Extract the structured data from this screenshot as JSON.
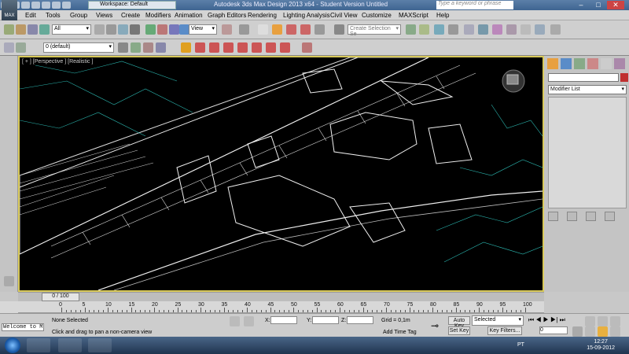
{
  "titlebar": {
    "workspace": "Workspace: Default",
    "title": "Autodesk 3ds Max Design 2013 x64    - Student Version    Untitled",
    "search_placeholder": "Type a keyword or phrase"
  },
  "menu": {
    "items": [
      "Edit",
      "Tools",
      "Group",
      "Views",
      "Create",
      "Modifiers",
      "Animation",
      "Graph Editors",
      "Rendering",
      "Lighting Analysis",
      "Civil View",
      "Customize",
      "MAXScript",
      "Help"
    ]
  },
  "toolbar": {
    "selection_filter": "All",
    "reference_coord": "View",
    "named_selection_placeholder": "Create Selection Se",
    "layer": "0 (default)"
  },
  "viewport": {
    "label": "[ + ] [Perspective ] [Realistic ]"
  },
  "command_panel": {
    "modifier_list": "Modifier List"
  },
  "timeline": {
    "frame_label": "0 / 100",
    "ticks": [
      "0",
      "5",
      "10",
      "15",
      "20",
      "25",
      "30",
      "35",
      "40",
      "45",
      "50",
      "55",
      "60",
      "65",
      "70",
      "75",
      "80",
      "85",
      "90",
      "95",
      "100"
    ]
  },
  "status": {
    "maxscript_text": "Welcome to M",
    "selection_status": "None Selected",
    "prompt": "Click and drag to pan a non-camera view",
    "x_label": "X:",
    "y_label": "Y:",
    "z_label": "Z:",
    "grid": "Grid = 0,1m",
    "add_time_tag": "Add Time Tag",
    "auto_key": "Auto Key",
    "set_key": "Set Key",
    "selected_option": "Selected",
    "key_filters": "Key Filters...",
    "frame_value": "0"
  },
  "taskbar": {
    "lang": "PT",
    "time": "12:27",
    "date": "15-09-2012"
  },
  "colors": {
    "viewport_border": "#d8c95a",
    "titlebar": "#3f6591"
  }
}
